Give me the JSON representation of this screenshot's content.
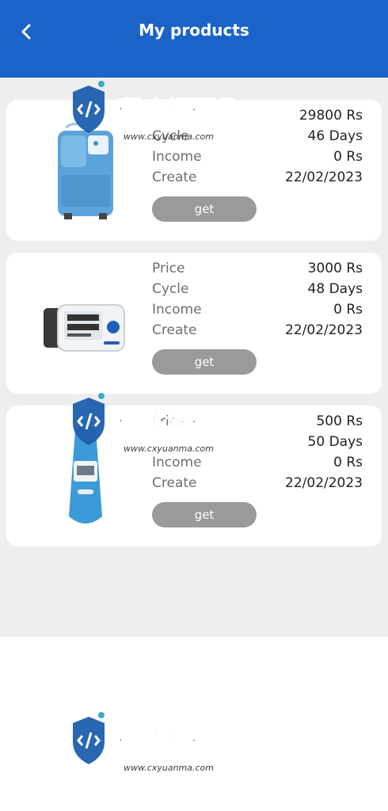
{
  "header": {
    "back_icon": "chevron-left-icon",
    "title": "My products"
  },
  "products": [
    {
      "image": "oxygen-concentrator",
      "price_label": "",
      "price_value": "29800 Rs",
      "cycle_label": "Cycle",
      "cycle_value": "46 Days",
      "income_label": "Income",
      "income_value": "0 Rs",
      "create_label": "Create",
      "create_value": "22/02/2023",
      "button_label": "get"
    },
    {
      "image": "blood-pressure-monitor",
      "price_label": "Price",
      "price_value": "3000 Rs",
      "cycle_label": "Cycle",
      "cycle_value": "48 Days",
      "income_label": "Income",
      "income_value": "0 Rs",
      "create_label": "Create",
      "create_value": "22/02/2023",
      "button_label": "get"
    },
    {
      "image": "ear-thermometer",
      "price_label": "Price",
      "price_value": "500 Rs",
      "cycle_label": "",
      "cycle_value": "50 Days",
      "income_label": "Income",
      "income_value": "0 Rs",
      "create_label": "Create",
      "create_value": "22/02/2023",
      "button_label": "get"
    }
  ],
  "watermark": {
    "text_cn": "程序源码网",
    "text_url": "www.cxyuanma.com"
  },
  "colors": {
    "header": "#1c63c9",
    "button": "#9a9a9a",
    "card": "#ffffff",
    "background": "#eeeeef"
  }
}
